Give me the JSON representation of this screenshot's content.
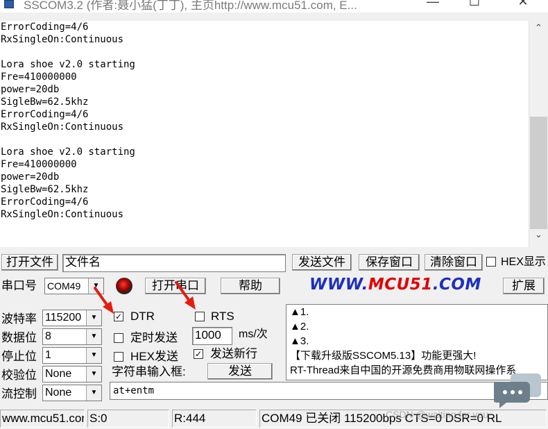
{
  "window": {
    "title": "SSCOM3.2 (作者:聂小猛(丁丁), 主页http://www.mcu51.com,  E...",
    "minimize": "—",
    "maximize": "☐",
    "close": "✕"
  },
  "terminal": {
    "lines": [
      "ErrorCoding=4/6",
      "RxSingleOn:Continuous",
      "",
      "Lora shoe v2.0 starting",
      "Fre=410000000",
      "power=20db",
      "SigleBw=62.5khz",
      "ErrorCoding=4/6",
      "RxSingleOn:Continuous",
      "",
      "Lora shoe v2.0 starting",
      "Fre=410000000",
      "power=20db",
      "SigleBw=62.5khz",
      "ErrorCoding=4/6",
      "RxSingleOn:Continuous"
    ]
  },
  "scroll": {
    "up": "⌃",
    "down": "⌄"
  },
  "toolbar1": {
    "open_file": "打开文件",
    "file_name": "文件名",
    "send_file": "发送文件",
    "save_window": "保存窗口",
    "clear_window": "清除窗口",
    "hex_display": "HEX显示"
  },
  "toolbar2": {
    "port_label": "串口号",
    "port_value": "COM49",
    "open_port": "打开串口",
    "help": "帮助",
    "logo_left": "WWW.",
    "logo_mid": "MCU51",
    "logo_right": ".COM",
    "expand": "扩展"
  },
  "settings": {
    "baud_label": "波特率",
    "baud_value": "115200",
    "databits_label": "数据位",
    "databits_value": "8",
    "stopbits_label": "停止位",
    "stopbits_value": "1",
    "parity_label": "校验位",
    "parity_value": "None",
    "flow_label": "流控制",
    "flow_value": "None"
  },
  "controls": {
    "dtr_label": "DTR",
    "dtr_checked": true,
    "rts_label": "RTS",
    "rts_checked": false,
    "timed_send_label": "定时发送",
    "timed_send_checked": false,
    "interval_value": "1000",
    "interval_unit": "ms/次",
    "hex_send_label": "HEX发送",
    "hex_send_checked": false,
    "send_newline_label": "发送新行",
    "send_newline_checked": true,
    "input_label": "字符串输入框:",
    "send_button": "发送",
    "input_value": "at+entm",
    "check_mark": "✓"
  },
  "info_panel": {
    "lines": [
      "▲1.",
      "▲2.",
      "▲3.",
      "【下载升级版SSCOM5.13】功能更强大!",
      "RT-Thread来自中国的开源免费商用物联网操作系"
    ]
  },
  "statusbar": {
    "url": "www.mcu51.cor",
    "sent": "S:0",
    "received": "R:444",
    "port_status": "COM49 已关闭  115200bps  CTS=0 DSR=0 RL"
  },
  "watermark": "CSDN @waiting for you",
  "colors": {
    "logo_blue": "#1c2fbf",
    "logo_red": "#e00000",
    "annotation_red": "#e8190f"
  }
}
